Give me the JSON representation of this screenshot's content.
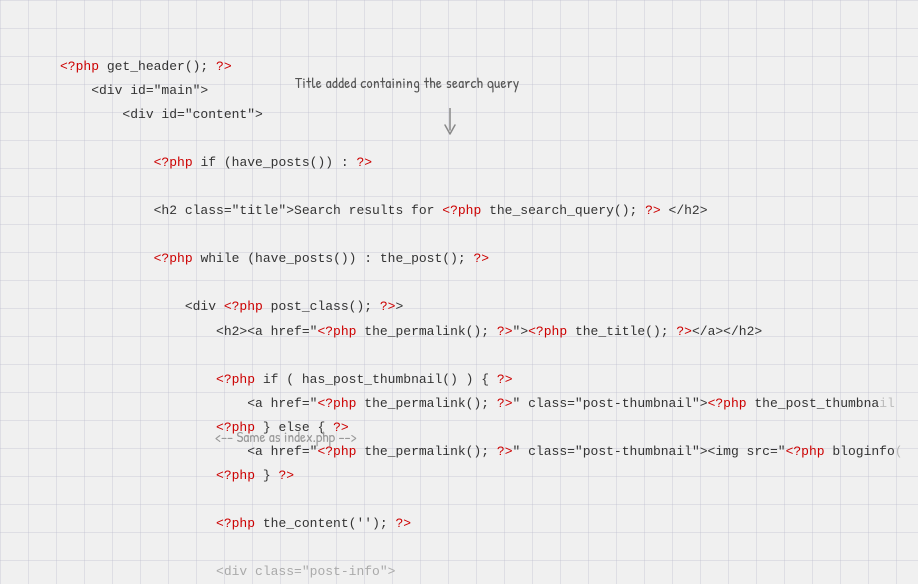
{
  "annotation": {
    "text": "Title added containing the search query",
    "arrow": "↓"
  },
  "bottom_comment": {
    "text": "<-- Same as index.php -->"
  },
  "code": {
    "lines": [
      {
        "id": "l1",
        "content": "<?php get_header(); ?>"
      },
      {
        "id": "l2",
        "content": "    <div id=\"main\">"
      },
      {
        "id": "l3",
        "content": "        <div id=\"content\">"
      },
      {
        "id": "l4",
        "content": ""
      },
      {
        "id": "l5",
        "content": "            <?php if (have_posts()) : ?>"
      },
      {
        "id": "l6",
        "content": ""
      },
      {
        "id": "l7",
        "content": "            <h2 class=\"title\">Search results for <?php the_search_query(); ?> </h2>"
      },
      {
        "id": "l8",
        "content": ""
      },
      {
        "id": "l9",
        "content": "            <?php while (have_posts()) : the_post(); ?>"
      },
      {
        "id": "l10",
        "content": ""
      },
      {
        "id": "l11",
        "content": "                <div <?php post_class(); ?>>"
      },
      {
        "id": "l12",
        "content": "                    <h2><a href=\"<?php the_permalink(); ?>\"><?php the_title(); ?></a></h2>"
      },
      {
        "id": "l13",
        "content": ""
      },
      {
        "id": "l14",
        "content": "                    <?php if ( has_post_thumbnail() ) { ?>"
      },
      {
        "id": "l15",
        "content": "                        <a href=\"<?php the_permalink(); ?>\" class=\"post-thumbnail\"><?php the_post_thumbnail("
      },
      {
        "id": "l16",
        "content": "                    <?php } else { ?>"
      },
      {
        "id": "l17",
        "content": "                        <a href=\"<?php the_permalink(); ?>\" class=\"post-thumbnail\"><img src=\"<?php bloginfo("
      },
      {
        "id": "l18",
        "content": "                    <?php } ?>"
      },
      {
        "id": "l19",
        "content": ""
      },
      {
        "id": "l20",
        "content": "                    <?php the_content(''); ?>"
      },
      {
        "id": "l21",
        "content": ""
      },
      {
        "id": "l22",
        "content": "                    <div class=\"post-info\">"
      }
    ]
  }
}
